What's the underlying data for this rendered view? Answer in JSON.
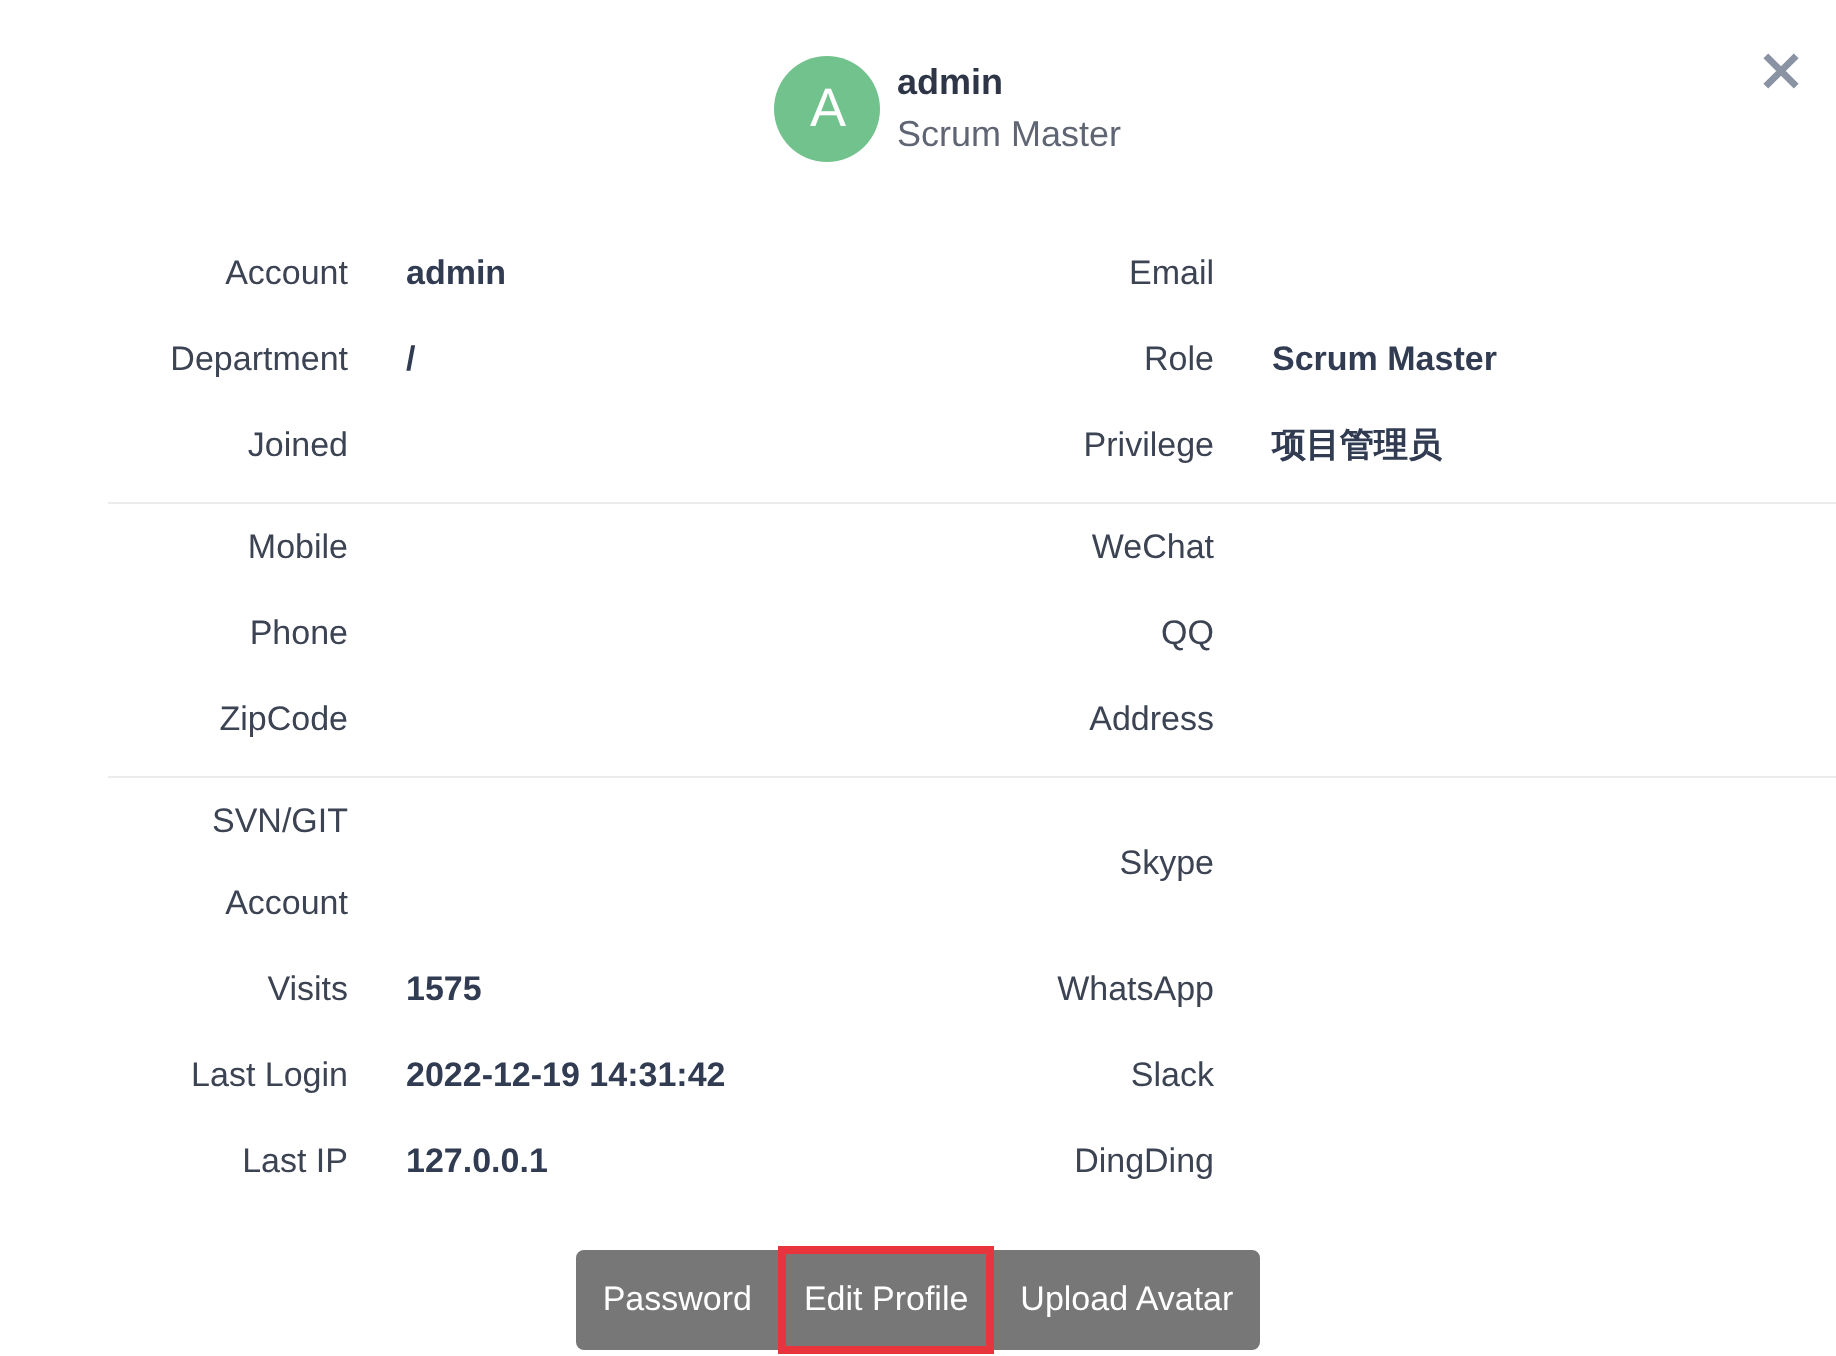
{
  "profile": {
    "avatar_letter": "A",
    "name": "admin",
    "role": "Scrum Master"
  },
  "sections": [
    {
      "rows": [
        [
          {
            "label": "Account",
            "value": "admin"
          },
          {
            "label": "Email"
          }
        ],
        [
          {
            "label": "Department",
            "value": "/"
          },
          {
            "label": "Role",
            "value": "Scrum Master"
          }
        ],
        [
          {
            "label": "Joined"
          },
          {
            "label": "Privilege",
            "value": "项目管理员"
          }
        ]
      ]
    },
    {
      "rows": [
        [
          {
            "label": "Mobile"
          },
          {
            "label": "WeChat"
          }
        ],
        [
          {
            "label": "Phone"
          },
          {
            "label": "QQ"
          }
        ],
        [
          {
            "label": "ZipCode"
          },
          {
            "label": "Address"
          }
        ]
      ]
    },
    {
      "rows": [
        [
          {
            "label": "SVN/GIT Account"
          },
          {
            "label": "Skype"
          }
        ],
        [
          {
            "label": "Visits",
            "value": "1575"
          },
          {
            "label": "WhatsApp"
          }
        ],
        [
          {
            "label": "Last Login",
            "value": "2022-12-19 14:31:42"
          },
          {
            "label": "Slack"
          }
        ],
        [
          {
            "label": "Last IP",
            "value": "127.0.0.1"
          },
          {
            "label": "DingDing"
          }
        ]
      ]
    }
  ],
  "buttons": [
    {
      "label": "Password",
      "highlighted": false
    },
    {
      "label": "Edit Profile",
      "highlighted": true
    },
    {
      "label": "Upload Avatar",
      "highlighted": false
    }
  ]
}
